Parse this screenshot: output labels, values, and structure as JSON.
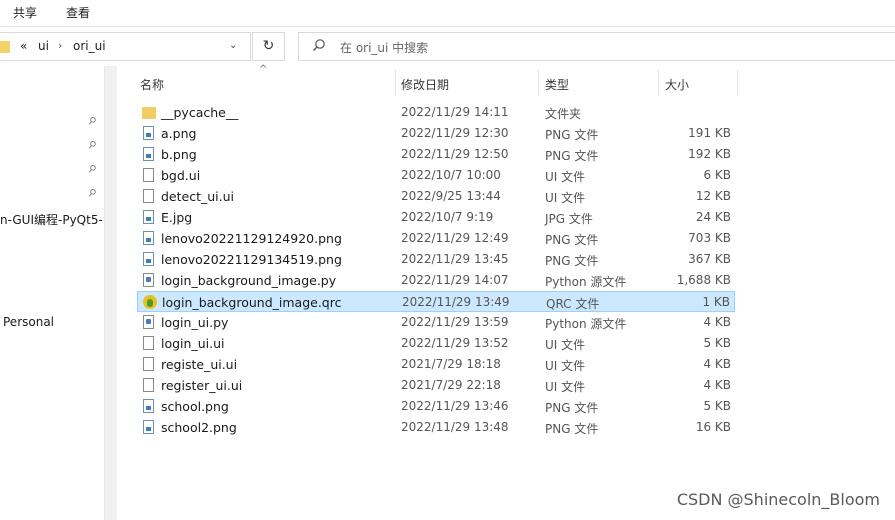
{
  "ribbon": {
    "tabs": [
      "共享",
      "查看"
    ]
  },
  "address": {
    "overflow": "«",
    "crumbs": [
      "ui",
      "ori_ui"
    ],
    "separator": "›",
    "dropdown": "⌄"
  },
  "refresh_glyph": "↻",
  "search": {
    "placeholder": "在 ori_ui 中搜索"
  },
  "nav": {
    "pins": [
      "⚲",
      "⚲",
      "⚲",
      "⚲"
    ],
    "items": [
      "n-GUI编程-PyQt5-",
      "Personal"
    ]
  },
  "columns": {
    "name": "名称",
    "date": "修改日期",
    "type": "类型",
    "size": "大小",
    "sort_indicator": "^"
  },
  "files": [
    {
      "icon": "folder-icon",
      "kind": "folder",
      "name": "__pycache__",
      "date": "2022/11/29 14:11",
      "type": "文件夹",
      "size": ""
    },
    {
      "icon": "png-file-icon",
      "kind": "png",
      "name": "a.png",
      "date": "2022/11/29 12:30",
      "type": "PNG 文件",
      "size": "191 KB"
    },
    {
      "icon": "png-file-icon",
      "kind": "png",
      "name": "b.png",
      "date": "2022/11/29 12:50",
      "type": "PNG 文件",
      "size": "192 KB"
    },
    {
      "icon": "ui-file-icon",
      "kind": "ui",
      "name": "bgd.ui",
      "date": "2022/10/7 10:00",
      "type": "UI 文件",
      "size": "6 KB"
    },
    {
      "icon": "ui-file-icon",
      "kind": "ui",
      "name": "detect_ui.ui",
      "date": "2022/9/25 13:44",
      "type": "UI 文件",
      "size": "12 KB"
    },
    {
      "icon": "jpg-file-icon",
      "kind": "jpg",
      "name": "E.jpg",
      "date": "2022/10/7 9:19",
      "type": "JPG 文件",
      "size": "24 KB"
    },
    {
      "icon": "png-file-icon",
      "kind": "png",
      "name": "lenovo20221129124920.png",
      "date": "2022/11/29 12:49",
      "type": "PNG 文件",
      "size": "703 KB"
    },
    {
      "icon": "png-file-icon",
      "kind": "png",
      "name": "lenovo20221129134519.png",
      "date": "2022/11/29 13:45",
      "type": "PNG 文件",
      "size": "367 KB"
    },
    {
      "icon": "python-file-icon",
      "kind": "py",
      "name": "login_background_image.py",
      "date": "2022/11/29 14:07",
      "type": "Python 源文件",
      "size": "1,688 KB"
    },
    {
      "icon": "qrc-file-icon",
      "kind": "qrc",
      "name": "login_background_image.qrc",
      "date": "2022/11/29 13:49",
      "type": "QRC 文件",
      "size": "1 KB",
      "selected": true
    },
    {
      "icon": "python-file-icon",
      "kind": "py",
      "name": "login_ui.py",
      "date": "2022/11/29 13:59",
      "type": "Python 源文件",
      "size": "4 KB"
    },
    {
      "icon": "ui-file-icon",
      "kind": "ui",
      "name": "login_ui.ui",
      "date": "2022/11/29 13:52",
      "type": "UI 文件",
      "size": "5 KB"
    },
    {
      "icon": "ui-file-icon",
      "kind": "ui",
      "name": "registe_ui.ui",
      "date": "2021/7/29 18:18",
      "type": "UI 文件",
      "size": "4 KB"
    },
    {
      "icon": "ui-file-icon",
      "kind": "ui",
      "name": "register_ui.ui",
      "date": "2021/7/29 22:18",
      "type": "UI 文件",
      "size": "4 KB"
    },
    {
      "icon": "png-file-icon",
      "kind": "png",
      "name": "school.png",
      "date": "2022/11/29 13:46",
      "type": "PNG 文件",
      "size": "5 KB"
    },
    {
      "icon": "png-file-icon",
      "kind": "png",
      "name": "school2.png",
      "date": "2022/11/29 13:48",
      "type": "PNG 文件",
      "size": "16 KB"
    }
  ],
  "watermark": "CSDN @Shinecoln_Bloom",
  "colors": {
    "selection_bg": "#cce8ff",
    "selection_border": "#99d1ff",
    "folder": "#f2cd63"
  }
}
